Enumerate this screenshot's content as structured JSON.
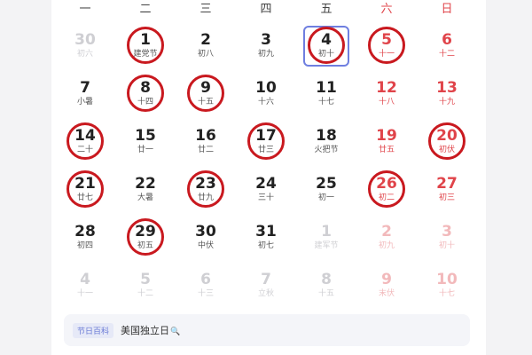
{
  "weekdays": [
    {
      "label": "一",
      "weekend": false
    },
    {
      "label": "二",
      "weekend": false
    },
    {
      "label": "三",
      "weekend": false
    },
    {
      "label": "四",
      "weekend": false
    },
    {
      "label": "五",
      "weekend": false
    },
    {
      "label": "六",
      "weekend": true
    },
    {
      "label": "日",
      "weekend": true
    }
  ],
  "days": [
    {
      "n": "30",
      "l": "初六",
      "other": true,
      "weekend": false,
      "circled": false,
      "selected": false
    },
    {
      "n": "1",
      "l": "建党节",
      "other": false,
      "weekend": false,
      "circled": true,
      "selected": false
    },
    {
      "n": "2",
      "l": "初八",
      "other": false,
      "weekend": false,
      "circled": false,
      "selected": false
    },
    {
      "n": "3",
      "l": "初九",
      "other": false,
      "weekend": false,
      "circled": false,
      "selected": false
    },
    {
      "n": "4",
      "l": "初十",
      "other": false,
      "weekend": false,
      "circled": true,
      "selected": true
    },
    {
      "n": "5",
      "l": "十一",
      "other": false,
      "weekend": true,
      "circled": true,
      "selected": false
    },
    {
      "n": "6",
      "l": "十二",
      "other": false,
      "weekend": true,
      "circled": false,
      "selected": false
    },
    {
      "n": "7",
      "l": "小暑",
      "other": false,
      "weekend": false,
      "circled": false,
      "selected": false
    },
    {
      "n": "8",
      "l": "十四",
      "other": false,
      "weekend": false,
      "circled": true,
      "selected": false
    },
    {
      "n": "9",
      "l": "十五",
      "other": false,
      "weekend": false,
      "circled": true,
      "selected": false
    },
    {
      "n": "10",
      "l": "十六",
      "other": false,
      "weekend": false,
      "circled": false,
      "selected": false
    },
    {
      "n": "11",
      "l": "十七",
      "other": false,
      "weekend": false,
      "circled": false,
      "selected": false
    },
    {
      "n": "12",
      "l": "十八",
      "other": false,
      "weekend": true,
      "circled": false,
      "selected": false
    },
    {
      "n": "13",
      "l": "十九",
      "other": false,
      "weekend": true,
      "circled": false,
      "selected": false
    },
    {
      "n": "14",
      "l": "二十",
      "other": false,
      "weekend": false,
      "circled": true,
      "selected": false
    },
    {
      "n": "15",
      "l": "廿一",
      "other": false,
      "weekend": false,
      "circled": false,
      "selected": false
    },
    {
      "n": "16",
      "l": "廿二",
      "other": false,
      "weekend": false,
      "circled": false,
      "selected": false
    },
    {
      "n": "17",
      "l": "廿三",
      "other": false,
      "weekend": false,
      "circled": true,
      "selected": false
    },
    {
      "n": "18",
      "l": "火把节",
      "other": false,
      "weekend": false,
      "circled": false,
      "selected": false
    },
    {
      "n": "19",
      "l": "廿五",
      "other": false,
      "weekend": true,
      "circled": false,
      "selected": false
    },
    {
      "n": "20",
      "l": "初伏",
      "other": false,
      "weekend": true,
      "circled": true,
      "selected": false
    },
    {
      "n": "21",
      "l": "廿七",
      "other": false,
      "weekend": false,
      "circled": true,
      "selected": false
    },
    {
      "n": "22",
      "l": "大暑",
      "other": false,
      "weekend": false,
      "circled": false,
      "selected": false
    },
    {
      "n": "23",
      "l": "廿九",
      "other": false,
      "weekend": false,
      "circled": true,
      "selected": false
    },
    {
      "n": "24",
      "l": "三十",
      "other": false,
      "weekend": false,
      "circled": false,
      "selected": false
    },
    {
      "n": "25",
      "l": "初一",
      "other": false,
      "weekend": false,
      "circled": false,
      "selected": false
    },
    {
      "n": "26",
      "l": "初二",
      "other": false,
      "weekend": true,
      "circled": true,
      "selected": false
    },
    {
      "n": "27",
      "l": "初三",
      "other": false,
      "weekend": true,
      "circled": false,
      "selected": false
    },
    {
      "n": "28",
      "l": "初四",
      "other": false,
      "weekend": false,
      "circled": false,
      "selected": false
    },
    {
      "n": "29",
      "l": "初五",
      "other": false,
      "weekend": false,
      "circled": true,
      "selected": false
    },
    {
      "n": "30",
      "l": "中伏",
      "other": false,
      "weekend": false,
      "circled": false,
      "selected": false
    },
    {
      "n": "31",
      "l": "初七",
      "other": false,
      "weekend": false,
      "circled": false,
      "selected": false
    },
    {
      "n": "1",
      "l": "建军节",
      "other": true,
      "weekend": false,
      "circled": false,
      "selected": false
    },
    {
      "n": "2",
      "l": "初九",
      "other": true,
      "weekend": true,
      "circled": false,
      "selected": false
    },
    {
      "n": "3",
      "l": "初十",
      "other": true,
      "weekend": true,
      "circled": false,
      "selected": false
    },
    {
      "n": "4",
      "l": "十一",
      "other": true,
      "weekend": false,
      "circled": false,
      "selected": false
    },
    {
      "n": "5",
      "l": "十二",
      "other": true,
      "weekend": false,
      "circled": false,
      "selected": false
    },
    {
      "n": "6",
      "l": "十三",
      "other": true,
      "weekend": false,
      "circled": false,
      "selected": false
    },
    {
      "n": "7",
      "l": "立秋",
      "other": true,
      "weekend": false,
      "circled": false,
      "selected": false
    },
    {
      "n": "8",
      "l": "十五",
      "other": true,
      "weekend": false,
      "circled": false,
      "selected": false
    },
    {
      "n": "9",
      "l": "末伏",
      "other": true,
      "weekend": true,
      "circled": false,
      "selected": false
    },
    {
      "n": "10",
      "l": "十七",
      "other": true,
      "weekend": true,
      "circled": false,
      "selected": false
    }
  ],
  "info": {
    "tag": "节日百科",
    "holiday": "美国独立日",
    "search_icon": "search-icon",
    "search_glyph": "🔍"
  },
  "colors": {
    "weekend": "#e0444a",
    "circle": "#c9191f",
    "selected_border": "#6f7fe0"
  }
}
